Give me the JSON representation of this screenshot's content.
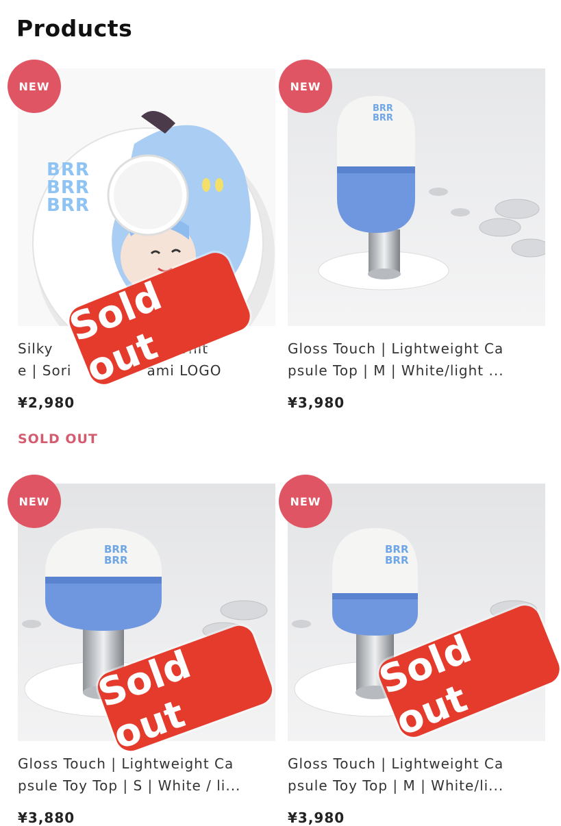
{
  "page": {
    "title": "Products"
  },
  "badges": {
    "new_label": "NEW"
  },
  "stamp": {
    "label": "Sold out"
  },
  "products": [
    {
      "name_line1": "Silky",
      "name_line1b": "disc| Whit",
      "name_line2": "e | Sori",
      "name_line2b": "ami LOGO",
      "price": "¥2,980",
      "status": "SOLD OUT",
      "disc_text": [
        "BRR",
        "BRR",
        "BRR"
      ]
    },
    {
      "name_line1": "Gloss Touch | Lightweight Ca",
      "name_line2": "psule Top | M | White/light ...",
      "price": "¥3,980",
      "cap_text": [
        "BRR",
        "BRR"
      ]
    },
    {
      "name_line1": "Gloss Touch | Lightweight Ca",
      "name_line2": "psule Toy Top | S | White / li...",
      "price": "¥3,880",
      "cap_text": [
        "BRR",
        "BRR"
      ]
    },
    {
      "name_line1": "Gloss Touch | Lightweight Ca",
      "name_line2": "psule Toy Top | M | White/li...",
      "price": "¥3,980",
      "cap_text": [
        "BRR",
        "BRR"
      ]
    }
  ],
  "colors": {
    "badge": "#e05563",
    "stamp": "#e43b2c",
    "sold_out_text": "#d45c70",
    "capsule_blue": "#6f97e0"
  }
}
